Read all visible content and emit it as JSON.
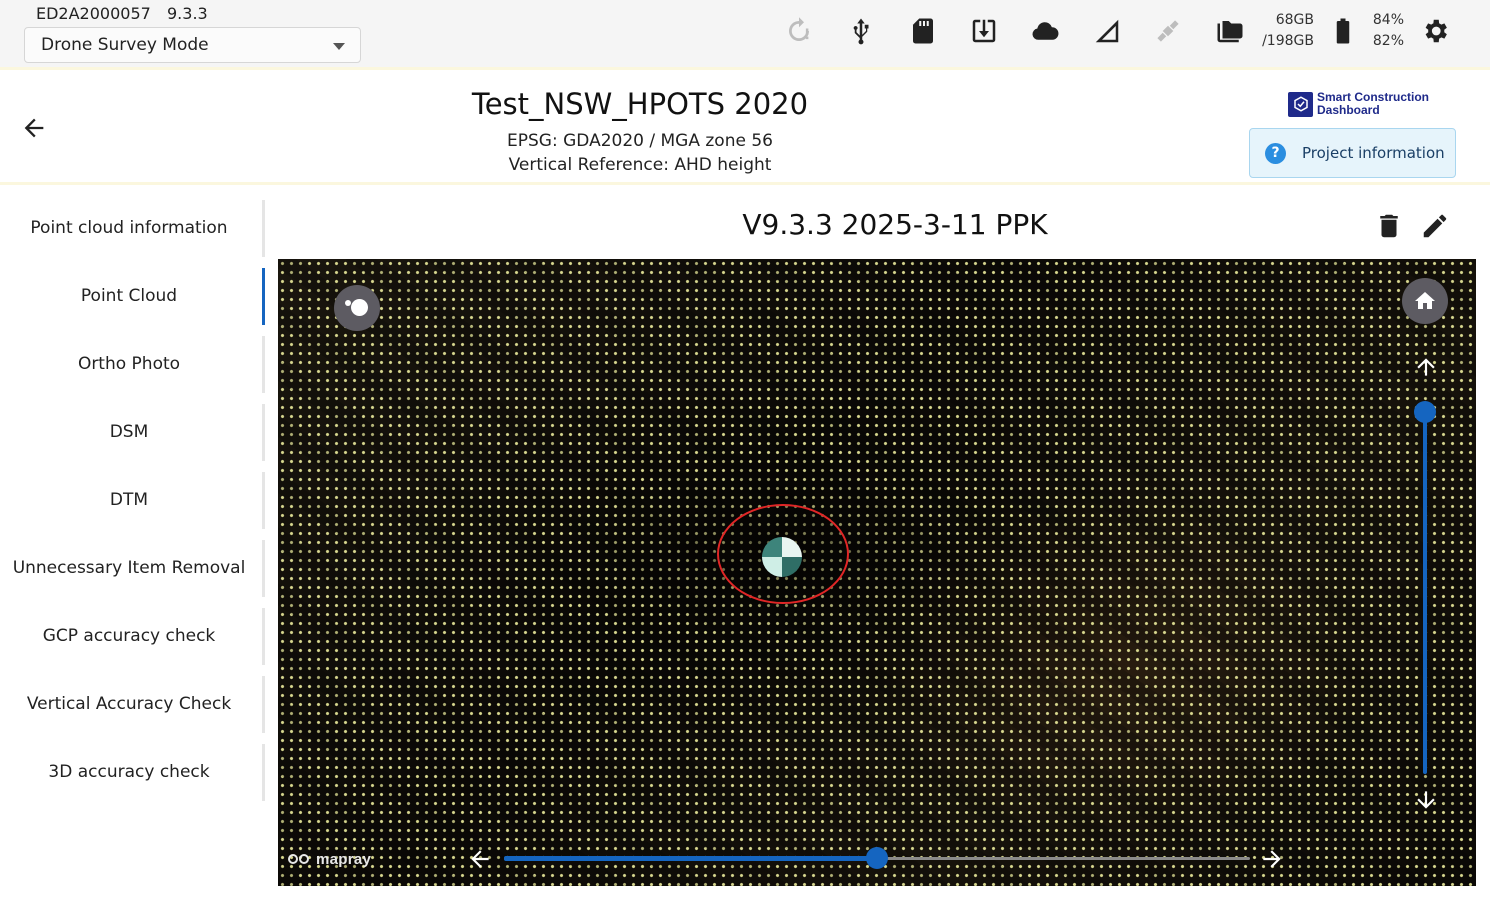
{
  "status_bar": {
    "device_id": "ED2A2000057",
    "version": "9.3.3",
    "mode_selected": "Drone Survey Mode",
    "icons": [
      "sync-warning-icon",
      "usb-icon",
      "sd-card-icon",
      "download-icon",
      "cloud-icon",
      "signal-icon",
      "satellite-icon",
      "folder-icon",
      "battery-icon",
      "settings-icon"
    ],
    "storage_used": "68GB",
    "storage_total": "/198GB",
    "battery_1": "84%",
    "battery_2": "82%"
  },
  "project": {
    "title": "Test_NSW_HPOTS 2020",
    "epsg": "EPSG: GDA2020 / MGA zone 56",
    "vertical_reference": "Vertical Reference: AHD height",
    "brand_line1": "Smart Construction",
    "brand_line2": "Dashboard",
    "info_button": "Project information"
  },
  "sidebar": {
    "active_index": 1,
    "items": [
      {
        "label": "Point cloud information"
      },
      {
        "label": "Point Cloud"
      },
      {
        "label": "Ortho Photo"
      },
      {
        "label": "DSM"
      },
      {
        "label": "DTM"
      },
      {
        "label": "Unnecessary Item Removal"
      },
      {
        "label": "GCP accuracy check"
      },
      {
        "label": "Vertical Accuracy Check"
      },
      {
        "label": "3D accuracy check"
      }
    ]
  },
  "content": {
    "version_title": "V9.3.3 2025-3-11 PPK",
    "viewer": {
      "attribution": "mapray",
      "vertical_slider_level": 0.97,
      "horizontal_slider_level": 0.5
    }
  },
  "colors": {
    "accent": "#1565c0",
    "highlight_ring": "#e02626",
    "info_button_bg": "#e6f4fb"
  }
}
